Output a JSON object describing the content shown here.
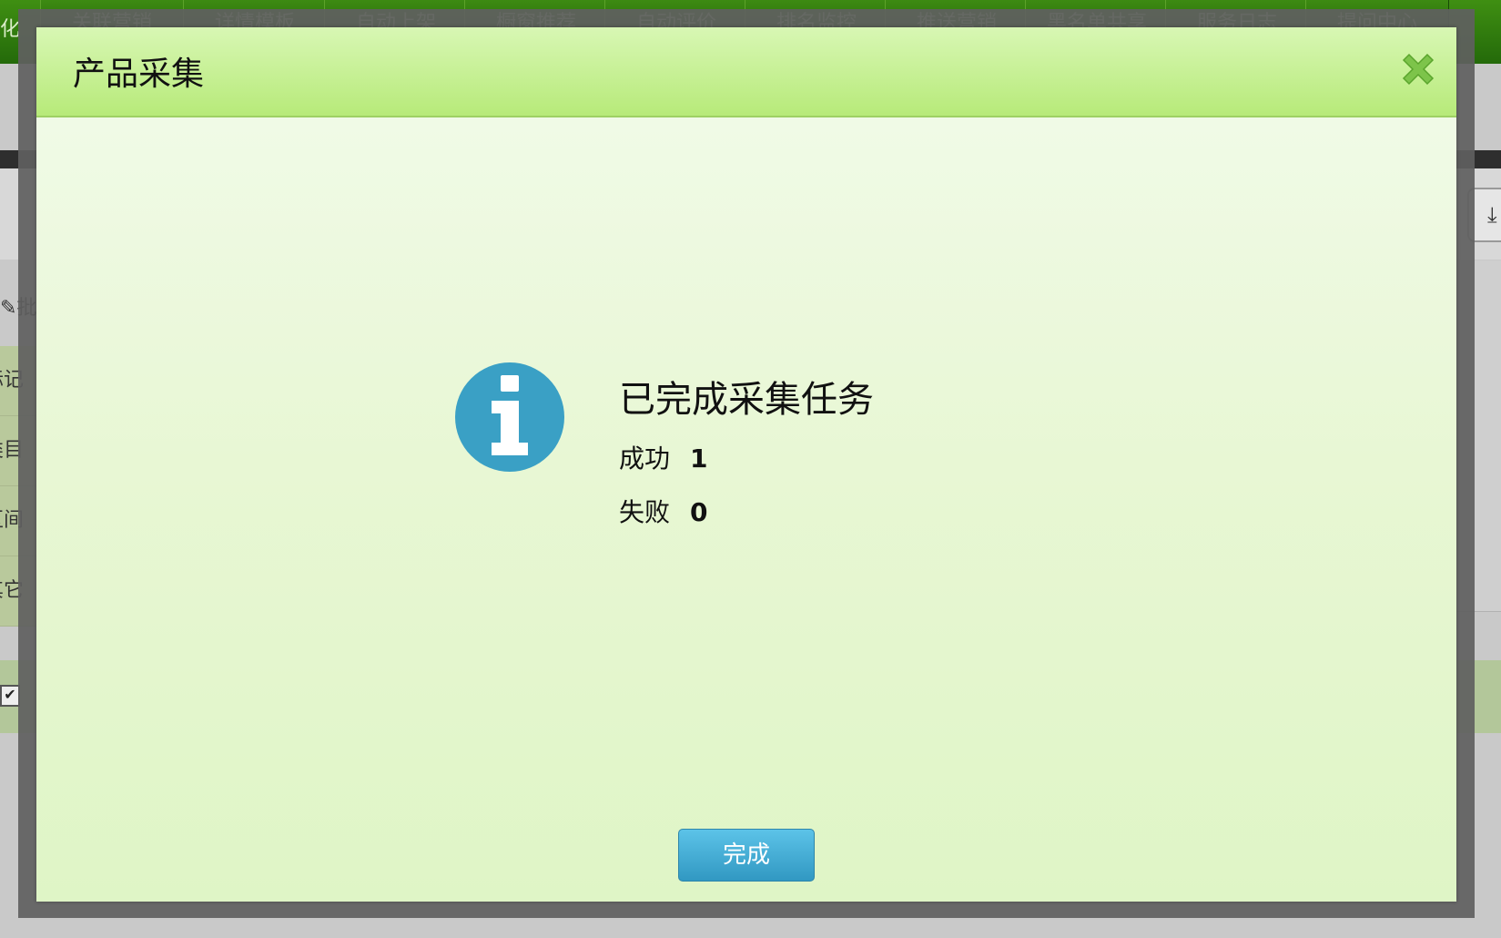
{
  "background": {
    "nav_first": "化",
    "nav_tabs": [
      "关联营销",
      "详情模板",
      "自动上架",
      "橱窗推荐",
      "自动评价",
      "排名监控",
      "推送营销",
      "黑名单共享",
      "服务日志",
      "提问中心"
    ],
    "side_pen_label": "批",
    "side_items": [
      "标记",
      "类目",
      "区间",
      "其它"
    ]
  },
  "dialog": {
    "title": "产品采集",
    "message_title": "已完成采集任务",
    "success_label": "成功",
    "success_value": "1",
    "fail_label": "失败",
    "fail_value": "0",
    "done_label": "完成"
  },
  "icons": {
    "close": "close-x-icon",
    "info": "info-circle-icon"
  },
  "colors": {
    "header_green": "#b7ea79",
    "close_green": "#7dc44a",
    "info_blue": "#3aa0c5",
    "button_blue": "#3198c2"
  }
}
